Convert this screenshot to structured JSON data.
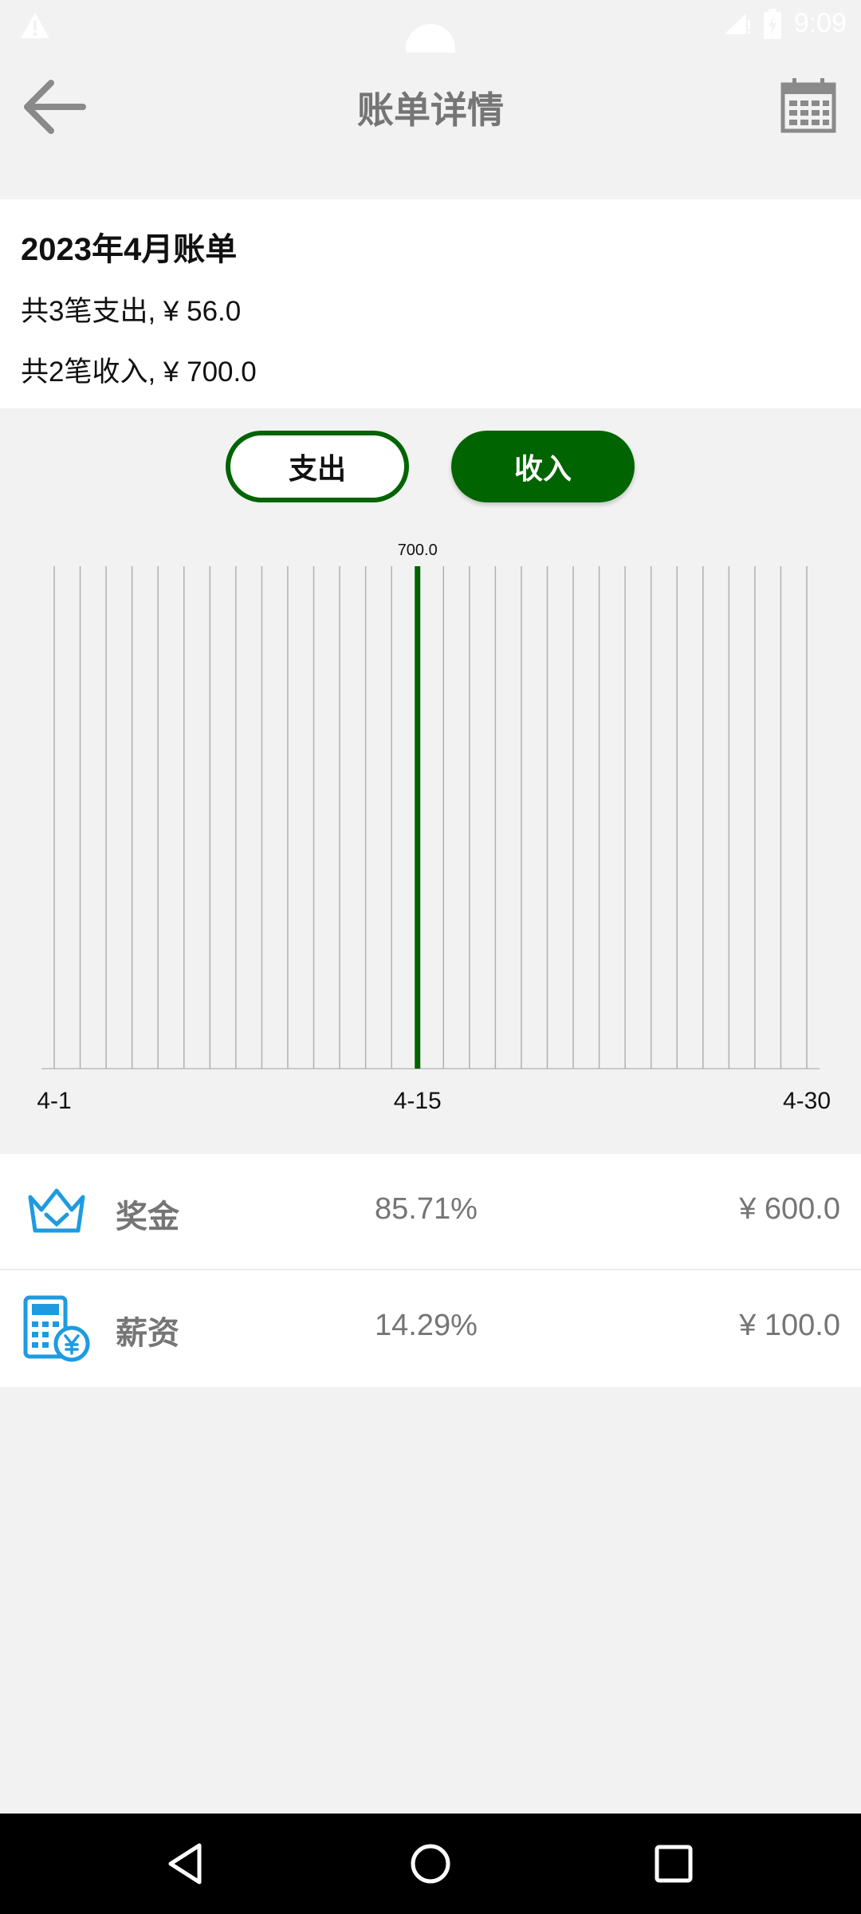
{
  "status_bar": {
    "time": "9:09"
  },
  "header": {
    "title": "账单详情",
    "back_icon": "arrow-left-icon",
    "calendar_icon": "calendar-icon"
  },
  "summary": {
    "title": "2023年4月账单",
    "expense_line": "共3笔支出, ¥ 56.0",
    "income_line": "共2笔收入, ¥ 700.0"
  },
  "toggle": {
    "expense_label": "支出",
    "income_label": "收入",
    "selected": "收入"
  },
  "chart_data": {
    "type": "bar",
    "x_tick_labels": [
      "4-1",
      "4-15",
      "4-30"
    ],
    "categories": [
      "4-1",
      "4-2",
      "4-3",
      "4-4",
      "4-5",
      "4-6",
      "4-7",
      "4-8",
      "4-9",
      "4-10",
      "4-11",
      "4-12",
      "4-13",
      "4-14",
      "4-15",
      "4-16",
      "4-17",
      "4-18",
      "4-19",
      "4-20",
      "4-21",
      "4-22",
      "4-23",
      "4-24",
      "4-25",
      "4-26",
      "4-27",
      "4-28",
      "4-29",
      "4-30"
    ],
    "values": [
      0,
      0,
      0,
      0,
      0,
      0,
      0,
      0,
      0,
      0,
      0,
      0,
      0,
      0,
      700.0,
      0,
      0,
      0,
      0,
      0,
      0,
      0,
      0,
      0,
      0,
      0,
      0,
      0,
      0,
      0
    ],
    "data_labels": [
      {
        "category": "4-15",
        "text": "700.0"
      }
    ],
    "bar_color": "#006400",
    "grid": true
  },
  "list": {
    "items": [
      {
        "name": "奖金",
        "percent": "85.71%",
        "amount": "¥ 600.0",
        "icon": "crown-icon"
      },
      {
        "name": "薪资",
        "percent": "14.29%",
        "amount": "¥ 100.0",
        "icon": "calculator-yen-icon"
      }
    ]
  },
  "colors": {
    "accent": "#006400",
    "icon_blue": "#1e9be0",
    "background": "#f2f2f2"
  }
}
